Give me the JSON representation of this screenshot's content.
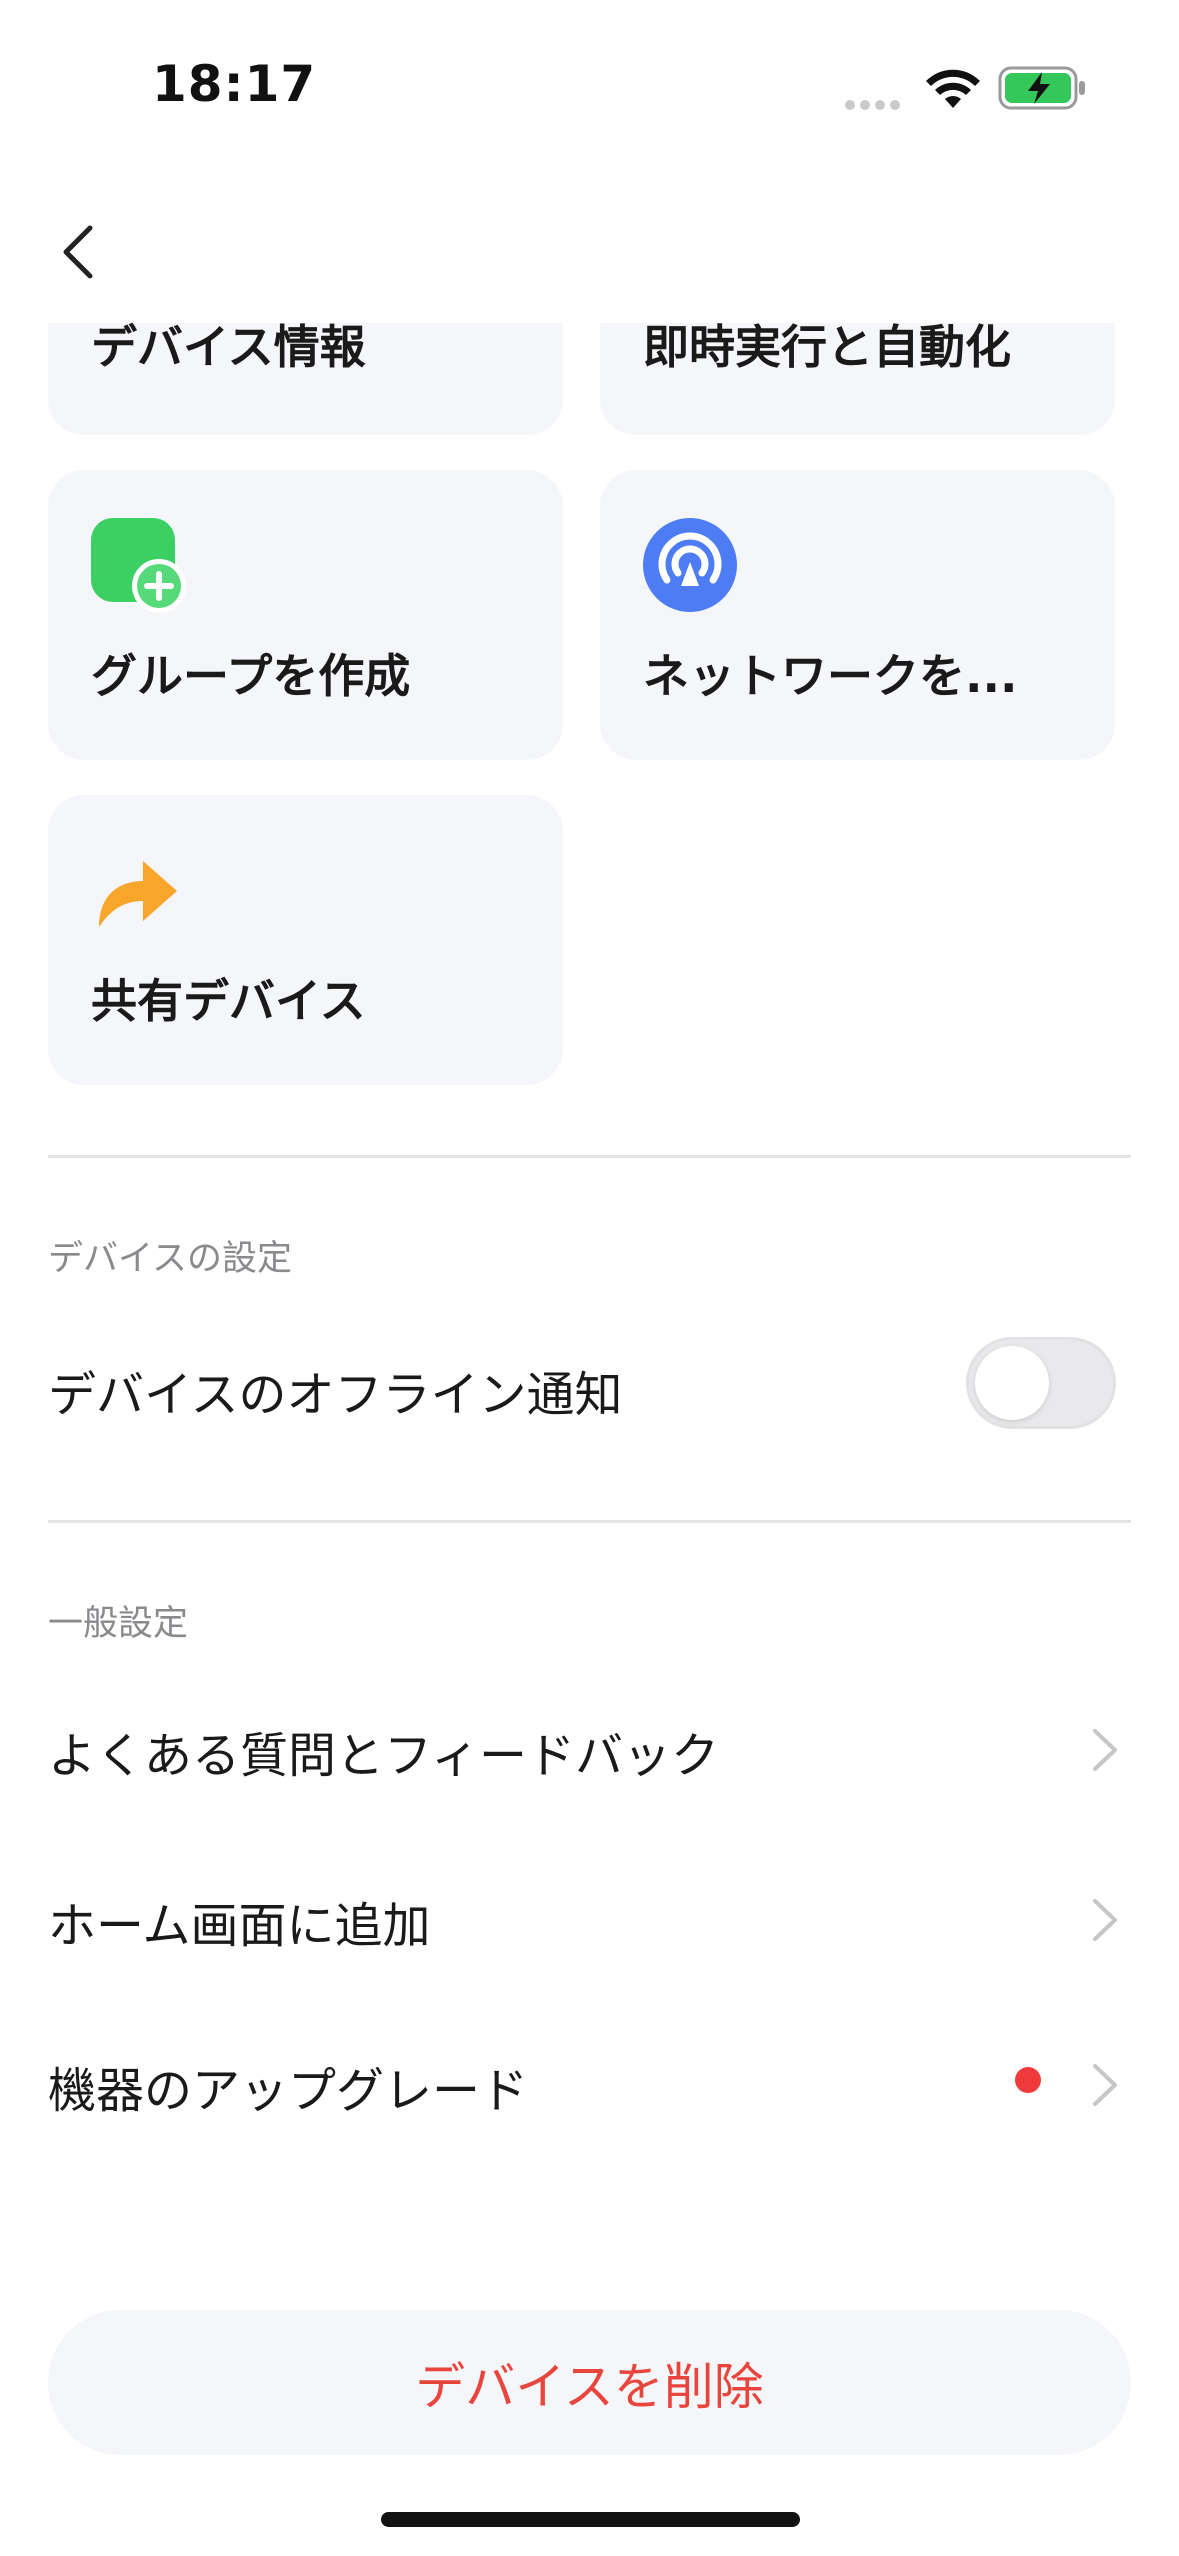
{
  "status_bar": {
    "time": "18:17"
  },
  "cards": [
    {
      "label": "デバイス情報"
    },
    {
      "label": "即時実行と自動化"
    },
    {
      "label": "グループを作成",
      "icon": "group-add-icon",
      "color": "#3ccf63"
    },
    {
      "label": "ネットワークを...",
      "icon": "network-signal-icon",
      "color": "#4d7cf4"
    },
    {
      "label": "共有デバイス",
      "icon": "share-arrow-icon",
      "color": "#f7a52b"
    }
  ],
  "device_settings": {
    "title": "デバイスの設定",
    "offline_notification": {
      "label": "デバイスのオフライン通知",
      "enabled": false
    }
  },
  "general_settings": {
    "title": "一般設定",
    "items": [
      {
        "label": "よくある質問とフィードバック"
      },
      {
        "label": "ホーム画面に追加"
      },
      {
        "label": "機器のアップグレード",
        "badge": true
      }
    ]
  },
  "delete_button": {
    "label": "デバイスを削除",
    "color": "#e8453c"
  }
}
